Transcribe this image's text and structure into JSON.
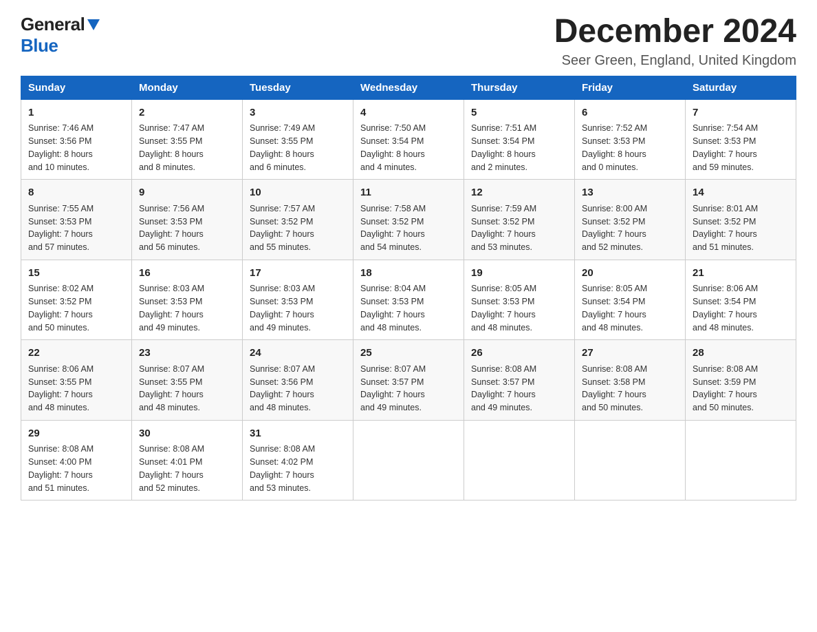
{
  "header": {
    "logo_general": "General",
    "logo_blue": "Blue",
    "title": "December 2024",
    "subtitle": "Seer Green, England, United Kingdom"
  },
  "columns": [
    "Sunday",
    "Monday",
    "Tuesday",
    "Wednesday",
    "Thursday",
    "Friday",
    "Saturday"
  ],
  "weeks": [
    [
      {
        "day": "1",
        "info": "Sunrise: 7:46 AM\nSunset: 3:56 PM\nDaylight: 8 hours\nand 10 minutes."
      },
      {
        "day": "2",
        "info": "Sunrise: 7:47 AM\nSunset: 3:55 PM\nDaylight: 8 hours\nand 8 minutes."
      },
      {
        "day": "3",
        "info": "Sunrise: 7:49 AM\nSunset: 3:55 PM\nDaylight: 8 hours\nand 6 minutes."
      },
      {
        "day": "4",
        "info": "Sunrise: 7:50 AM\nSunset: 3:54 PM\nDaylight: 8 hours\nand 4 minutes."
      },
      {
        "day": "5",
        "info": "Sunrise: 7:51 AM\nSunset: 3:54 PM\nDaylight: 8 hours\nand 2 minutes."
      },
      {
        "day": "6",
        "info": "Sunrise: 7:52 AM\nSunset: 3:53 PM\nDaylight: 8 hours\nand 0 minutes."
      },
      {
        "day": "7",
        "info": "Sunrise: 7:54 AM\nSunset: 3:53 PM\nDaylight: 7 hours\nand 59 minutes."
      }
    ],
    [
      {
        "day": "8",
        "info": "Sunrise: 7:55 AM\nSunset: 3:53 PM\nDaylight: 7 hours\nand 57 minutes."
      },
      {
        "day": "9",
        "info": "Sunrise: 7:56 AM\nSunset: 3:53 PM\nDaylight: 7 hours\nand 56 minutes."
      },
      {
        "day": "10",
        "info": "Sunrise: 7:57 AM\nSunset: 3:52 PM\nDaylight: 7 hours\nand 55 minutes."
      },
      {
        "day": "11",
        "info": "Sunrise: 7:58 AM\nSunset: 3:52 PM\nDaylight: 7 hours\nand 54 minutes."
      },
      {
        "day": "12",
        "info": "Sunrise: 7:59 AM\nSunset: 3:52 PM\nDaylight: 7 hours\nand 53 minutes."
      },
      {
        "day": "13",
        "info": "Sunrise: 8:00 AM\nSunset: 3:52 PM\nDaylight: 7 hours\nand 52 minutes."
      },
      {
        "day": "14",
        "info": "Sunrise: 8:01 AM\nSunset: 3:52 PM\nDaylight: 7 hours\nand 51 minutes."
      }
    ],
    [
      {
        "day": "15",
        "info": "Sunrise: 8:02 AM\nSunset: 3:52 PM\nDaylight: 7 hours\nand 50 minutes."
      },
      {
        "day": "16",
        "info": "Sunrise: 8:03 AM\nSunset: 3:53 PM\nDaylight: 7 hours\nand 49 minutes."
      },
      {
        "day": "17",
        "info": "Sunrise: 8:03 AM\nSunset: 3:53 PM\nDaylight: 7 hours\nand 49 minutes."
      },
      {
        "day": "18",
        "info": "Sunrise: 8:04 AM\nSunset: 3:53 PM\nDaylight: 7 hours\nand 48 minutes."
      },
      {
        "day": "19",
        "info": "Sunrise: 8:05 AM\nSunset: 3:53 PM\nDaylight: 7 hours\nand 48 minutes."
      },
      {
        "day": "20",
        "info": "Sunrise: 8:05 AM\nSunset: 3:54 PM\nDaylight: 7 hours\nand 48 minutes."
      },
      {
        "day": "21",
        "info": "Sunrise: 8:06 AM\nSunset: 3:54 PM\nDaylight: 7 hours\nand 48 minutes."
      }
    ],
    [
      {
        "day": "22",
        "info": "Sunrise: 8:06 AM\nSunset: 3:55 PM\nDaylight: 7 hours\nand 48 minutes."
      },
      {
        "day": "23",
        "info": "Sunrise: 8:07 AM\nSunset: 3:55 PM\nDaylight: 7 hours\nand 48 minutes."
      },
      {
        "day": "24",
        "info": "Sunrise: 8:07 AM\nSunset: 3:56 PM\nDaylight: 7 hours\nand 48 minutes."
      },
      {
        "day": "25",
        "info": "Sunrise: 8:07 AM\nSunset: 3:57 PM\nDaylight: 7 hours\nand 49 minutes."
      },
      {
        "day": "26",
        "info": "Sunrise: 8:08 AM\nSunset: 3:57 PM\nDaylight: 7 hours\nand 49 minutes."
      },
      {
        "day": "27",
        "info": "Sunrise: 8:08 AM\nSunset: 3:58 PM\nDaylight: 7 hours\nand 50 minutes."
      },
      {
        "day": "28",
        "info": "Sunrise: 8:08 AM\nSunset: 3:59 PM\nDaylight: 7 hours\nand 50 minutes."
      }
    ],
    [
      {
        "day": "29",
        "info": "Sunrise: 8:08 AM\nSunset: 4:00 PM\nDaylight: 7 hours\nand 51 minutes."
      },
      {
        "day": "30",
        "info": "Sunrise: 8:08 AM\nSunset: 4:01 PM\nDaylight: 7 hours\nand 52 minutes."
      },
      {
        "day": "31",
        "info": "Sunrise: 8:08 AM\nSunset: 4:02 PM\nDaylight: 7 hours\nand 53 minutes."
      },
      {
        "day": "",
        "info": ""
      },
      {
        "day": "",
        "info": ""
      },
      {
        "day": "",
        "info": ""
      },
      {
        "day": "",
        "info": ""
      }
    ]
  ]
}
